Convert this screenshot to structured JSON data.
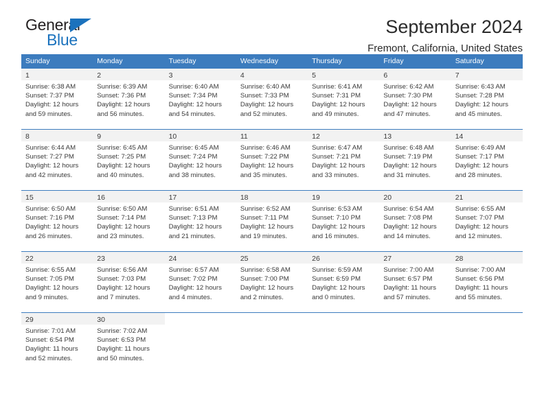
{
  "logo": {
    "word_top": "General",
    "word_bottom": "Blue",
    "triangle_icon": "triangle-icon",
    "color_dark": "#231f20",
    "color_blue": "#1b72bd"
  },
  "header": {
    "title": "September 2024",
    "subtitle": "Fremont, California, United States"
  },
  "theme": {
    "header_blue": "#3c7cbe",
    "daynum_bg": "#f2f2f2",
    "text": "#3a3a3a"
  },
  "calendar": {
    "weekdays": [
      "Sunday",
      "Monday",
      "Tuesday",
      "Wednesday",
      "Thursday",
      "Friday",
      "Saturday"
    ],
    "labels": {
      "sunrise": "Sunrise:",
      "sunset": "Sunset:",
      "daylight": "Daylight:"
    },
    "weeks": [
      [
        {
          "day": "1",
          "sunrise": "Sunrise: 6:38 AM",
          "sunset": "Sunset: 7:37 PM",
          "daylight_1": "Daylight: 12 hours",
          "daylight_2": "and 59 minutes."
        },
        {
          "day": "2",
          "sunrise": "Sunrise: 6:39 AM",
          "sunset": "Sunset: 7:36 PM",
          "daylight_1": "Daylight: 12 hours",
          "daylight_2": "and 56 minutes."
        },
        {
          "day": "3",
          "sunrise": "Sunrise: 6:40 AM",
          "sunset": "Sunset: 7:34 PM",
          "daylight_1": "Daylight: 12 hours",
          "daylight_2": "and 54 minutes."
        },
        {
          "day": "4",
          "sunrise": "Sunrise: 6:40 AM",
          "sunset": "Sunset: 7:33 PM",
          "daylight_1": "Daylight: 12 hours",
          "daylight_2": "and 52 minutes."
        },
        {
          "day": "5",
          "sunrise": "Sunrise: 6:41 AM",
          "sunset": "Sunset: 7:31 PM",
          "daylight_1": "Daylight: 12 hours",
          "daylight_2": "and 49 minutes."
        },
        {
          "day": "6",
          "sunrise": "Sunrise: 6:42 AM",
          "sunset": "Sunset: 7:30 PM",
          "daylight_1": "Daylight: 12 hours",
          "daylight_2": "and 47 minutes."
        },
        {
          "day": "7",
          "sunrise": "Sunrise: 6:43 AM",
          "sunset": "Sunset: 7:28 PM",
          "daylight_1": "Daylight: 12 hours",
          "daylight_2": "and 45 minutes."
        }
      ],
      [
        {
          "day": "8",
          "sunrise": "Sunrise: 6:44 AM",
          "sunset": "Sunset: 7:27 PM",
          "daylight_1": "Daylight: 12 hours",
          "daylight_2": "and 42 minutes."
        },
        {
          "day": "9",
          "sunrise": "Sunrise: 6:45 AM",
          "sunset": "Sunset: 7:25 PM",
          "daylight_1": "Daylight: 12 hours",
          "daylight_2": "and 40 minutes."
        },
        {
          "day": "10",
          "sunrise": "Sunrise: 6:45 AM",
          "sunset": "Sunset: 7:24 PM",
          "daylight_1": "Daylight: 12 hours",
          "daylight_2": "and 38 minutes."
        },
        {
          "day": "11",
          "sunrise": "Sunrise: 6:46 AM",
          "sunset": "Sunset: 7:22 PM",
          "daylight_1": "Daylight: 12 hours",
          "daylight_2": "and 35 minutes."
        },
        {
          "day": "12",
          "sunrise": "Sunrise: 6:47 AM",
          "sunset": "Sunset: 7:21 PM",
          "daylight_1": "Daylight: 12 hours",
          "daylight_2": "and 33 minutes."
        },
        {
          "day": "13",
          "sunrise": "Sunrise: 6:48 AM",
          "sunset": "Sunset: 7:19 PM",
          "daylight_1": "Daylight: 12 hours",
          "daylight_2": "and 31 minutes."
        },
        {
          "day": "14",
          "sunrise": "Sunrise: 6:49 AM",
          "sunset": "Sunset: 7:17 PM",
          "daylight_1": "Daylight: 12 hours",
          "daylight_2": "and 28 minutes."
        }
      ],
      [
        {
          "day": "15",
          "sunrise": "Sunrise: 6:50 AM",
          "sunset": "Sunset: 7:16 PM",
          "daylight_1": "Daylight: 12 hours",
          "daylight_2": "and 26 minutes."
        },
        {
          "day": "16",
          "sunrise": "Sunrise: 6:50 AM",
          "sunset": "Sunset: 7:14 PM",
          "daylight_1": "Daylight: 12 hours",
          "daylight_2": "and 23 minutes."
        },
        {
          "day": "17",
          "sunrise": "Sunrise: 6:51 AM",
          "sunset": "Sunset: 7:13 PM",
          "daylight_1": "Daylight: 12 hours",
          "daylight_2": "and 21 minutes."
        },
        {
          "day": "18",
          "sunrise": "Sunrise: 6:52 AM",
          "sunset": "Sunset: 7:11 PM",
          "daylight_1": "Daylight: 12 hours",
          "daylight_2": "and 19 minutes."
        },
        {
          "day": "19",
          "sunrise": "Sunrise: 6:53 AM",
          "sunset": "Sunset: 7:10 PM",
          "daylight_1": "Daylight: 12 hours",
          "daylight_2": "and 16 minutes."
        },
        {
          "day": "20",
          "sunrise": "Sunrise: 6:54 AM",
          "sunset": "Sunset: 7:08 PM",
          "daylight_1": "Daylight: 12 hours",
          "daylight_2": "and 14 minutes."
        },
        {
          "day": "21",
          "sunrise": "Sunrise: 6:55 AM",
          "sunset": "Sunset: 7:07 PM",
          "daylight_1": "Daylight: 12 hours",
          "daylight_2": "and 12 minutes."
        }
      ],
      [
        {
          "day": "22",
          "sunrise": "Sunrise: 6:55 AM",
          "sunset": "Sunset: 7:05 PM",
          "daylight_1": "Daylight: 12 hours",
          "daylight_2": "and 9 minutes."
        },
        {
          "day": "23",
          "sunrise": "Sunrise: 6:56 AM",
          "sunset": "Sunset: 7:03 PM",
          "daylight_1": "Daylight: 12 hours",
          "daylight_2": "and 7 minutes."
        },
        {
          "day": "24",
          "sunrise": "Sunrise: 6:57 AM",
          "sunset": "Sunset: 7:02 PM",
          "daylight_1": "Daylight: 12 hours",
          "daylight_2": "and 4 minutes."
        },
        {
          "day": "25",
          "sunrise": "Sunrise: 6:58 AM",
          "sunset": "Sunset: 7:00 PM",
          "daylight_1": "Daylight: 12 hours",
          "daylight_2": "and 2 minutes."
        },
        {
          "day": "26",
          "sunrise": "Sunrise: 6:59 AM",
          "sunset": "Sunset: 6:59 PM",
          "daylight_1": "Daylight: 12 hours",
          "daylight_2": "and 0 minutes."
        },
        {
          "day": "27",
          "sunrise": "Sunrise: 7:00 AM",
          "sunset": "Sunset: 6:57 PM",
          "daylight_1": "Daylight: 11 hours",
          "daylight_2": "and 57 minutes."
        },
        {
          "day": "28",
          "sunrise": "Sunrise: 7:00 AM",
          "sunset": "Sunset: 6:56 PM",
          "daylight_1": "Daylight: 11 hours",
          "daylight_2": "and 55 minutes."
        }
      ],
      [
        {
          "day": "29",
          "sunrise": "Sunrise: 7:01 AM",
          "sunset": "Sunset: 6:54 PM",
          "daylight_1": "Daylight: 11 hours",
          "daylight_2": "and 52 minutes."
        },
        {
          "day": "30",
          "sunrise": "Sunrise: 7:02 AM",
          "sunset": "Sunset: 6:53 PM",
          "daylight_1": "Daylight: 11 hours",
          "daylight_2": "and 50 minutes."
        },
        {
          "day": "",
          "sunrise": "",
          "sunset": "",
          "daylight_1": "",
          "daylight_2": ""
        },
        {
          "day": "",
          "sunrise": "",
          "sunset": "",
          "daylight_1": "",
          "daylight_2": ""
        },
        {
          "day": "",
          "sunrise": "",
          "sunset": "",
          "daylight_1": "",
          "daylight_2": ""
        },
        {
          "day": "",
          "sunrise": "",
          "sunset": "",
          "daylight_1": "",
          "daylight_2": ""
        },
        {
          "day": "",
          "sunrise": "",
          "sunset": "",
          "daylight_1": "",
          "daylight_2": ""
        }
      ]
    ]
  }
}
